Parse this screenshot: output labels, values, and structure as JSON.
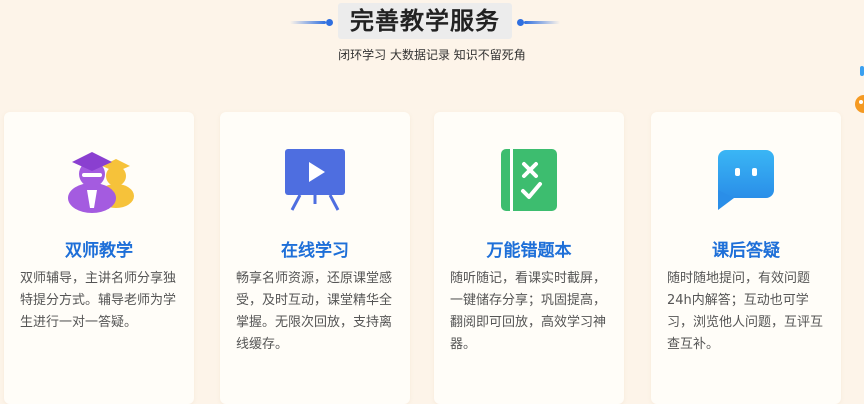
{
  "header": {
    "title": "完善教学服务",
    "subtitle": "闭环学习  大数据记录  知识不留死角"
  },
  "colors": {
    "accent": "#1e6fd8",
    "background": "#fdf4e9",
    "card": "#fffdf8"
  },
  "cards": [
    {
      "icon": "dual-teacher-icon",
      "title": "双师教学",
      "desc": "双师辅导，主讲名师分享独特提分方式。辅导老师为学生进行一对一答疑。"
    },
    {
      "icon": "presentation-play-icon",
      "title": "在线学习",
      "desc": "畅享名师资源，还原课堂感受，及时互动，课堂精华全掌握。无限次回放，支持离线缓存。"
    },
    {
      "icon": "error-notebook-icon",
      "title": "万能错题本",
      "desc": "随听随记，看课实时截屏，一键储存分享；巩固提高，翻阅即可回放，高效学习神器。"
    },
    {
      "icon": "chat-bubble-icon",
      "title": "课后答疑",
      "desc": "随时随地提问，有效问题24h内解答；互动也可学习，浏览他人问题，互评互查互补。"
    }
  ]
}
